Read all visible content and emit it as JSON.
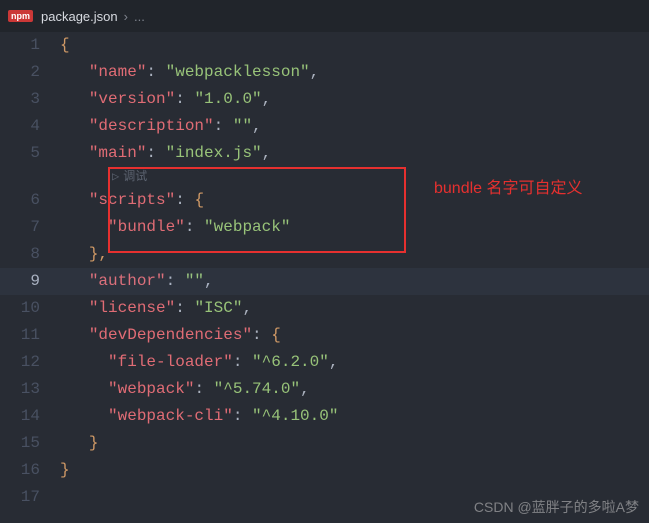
{
  "tab": {
    "badge": "npm",
    "filename": "package.json",
    "crumb_sep": "›",
    "crumb_rest": "..."
  },
  "hint": {
    "arrow": "▷",
    "label": "调试"
  },
  "code": {
    "l1_open": "{",
    "k_name": "\"name\"",
    "v_name": "\"webpacklesson\"",
    "k_version": "\"version\"",
    "v_version": "\"1.0.0\"",
    "k_description": "\"description\"",
    "v_description": "\"\"",
    "k_main": "\"main\"",
    "v_main": "\"index.js\"",
    "k_scripts": "\"scripts\"",
    "k_bundle": "\"bundle\"",
    "v_bundle": "\"webpack\"",
    "k_author": "\"author\"",
    "v_author": "\"\"",
    "k_license": "\"license\"",
    "v_license": "\"ISC\"",
    "k_devdeps": "\"devDependencies\"",
    "k_fileloader": "\"file-loader\"",
    "v_fileloader": "\"^6.2.0\"",
    "k_webpack": "\"webpack\"",
    "v_webpack": "\"^5.74.0\"",
    "k_webpackcli": "\"webpack-cli\"",
    "v_webpackcli": "\"^4.10.0\"",
    "close_brace": "}",
    "comma": ",",
    "colon": ": ",
    "obj_open": "{",
    "obj_close_comma": "},"
  },
  "lines": [
    "1",
    "2",
    "3",
    "4",
    "5",
    "6",
    "7",
    "8",
    "9",
    "10",
    "11",
    "12",
    "13",
    "14",
    "15",
    "16",
    "17"
  ],
  "active_line": "9",
  "annotation": "bundle 名字可自定义",
  "watermark": "CSDN @蓝胖子的多啦A梦"
}
